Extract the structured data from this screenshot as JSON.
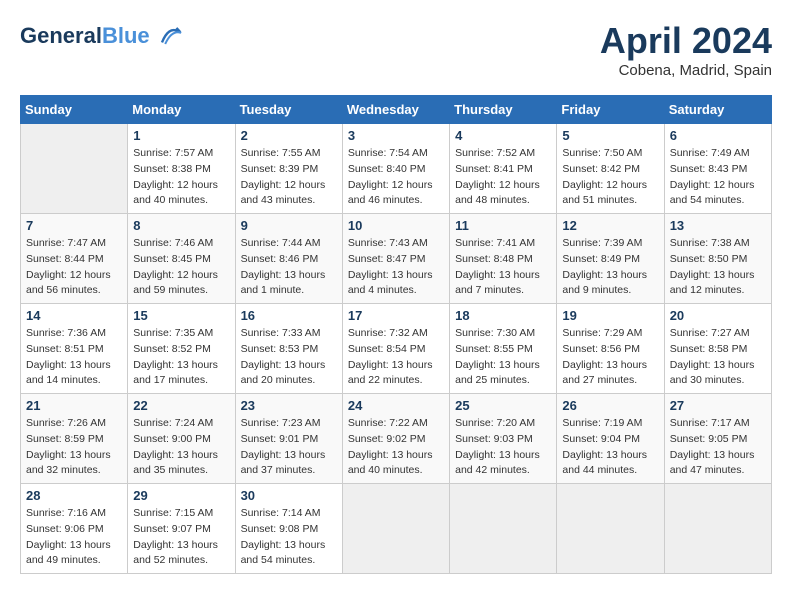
{
  "header": {
    "logo_line1": "General",
    "logo_line2": "Blue",
    "month": "April 2024",
    "location": "Cobena, Madrid, Spain"
  },
  "weekdays": [
    "Sunday",
    "Monday",
    "Tuesday",
    "Wednesday",
    "Thursday",
    "Friday",
    "Saturday"
  ],
  "weeks": [
    [
      {
        "day": null
      },
      {
        "day": "1",
        "sunrise": "7:57 AM",
        "sunset": "8:38 PM",
        "daylight": "12 hours and 40 minutes."
      },
      {
        "day": "2",
        "sunrise": "7:55 AM",
        "sunset": "8:39 PM",
        "daylight": "12 hours and 43 minutes."
      },
      {
        "day": "3",
        "sunrise": "7:54 AM",
        "sunset": "8:40 PM",
        "daylight": "12 hours and 46 minutes."
      },
      {
        "day": "4",
        "sunrise": "7:52 AM",
        "sunset": "8:41 PM",
        "daylight": "12 hours and 48 minutes."
      },
      {
        "day": "5",
        "sunrise": "7:50 AM",
        "sunset": "8:42 PM",
        "daylight": "12 hours and 51 minutes."
      },
      {
        "day": "6",
        "sunrise": "7:49 AM",
        "sunset": "8:43 PM",
        "daylight": "12 hours and 54 minutes."
      }
    ],
    [
      {
        "day": "7",
        "sunrise": "7:47 AM",
        "sunset": "8:44 PM",
        "daylight": "12 hours and 56 minutes."
      },
      {
        "day": "8",
        "sunrise": "7:46 AM",
        "sunset": "8:45 PM",
        "daylight": "12 hours and 59 minutes."
      },
      {
        "day": "9",
        "sunrise": "7:44 AM",
        "sunset": "8:46 PM",
        "daylight": "13 hours and 1 minute."
      },
      {
        "day": "10",
        "sunrise": "7:43 AM",
        "sunset": "8:47 PM",
        "daylight": "13 hours and 4 minutes."
      },
      {
        "day": "11",
        "sunrise": "7:41 AM",
        "sunset": "8:48 PM",
        "daylight": "13 hours and 7 minutes."
      },
      {
        "day": "12",
        "sunrise": "7:39 AM",
        "sunset": "8:49 PM",
        "daylight": "13 hours and 9 minutes."
      },
      {
        "day": "13",
        "sunrise": "7:38 AM",
        "sunset": "8:50 PM",
        "daylight": "13 hours and 12 minutes."
      }
    ],
    [
      {
        "day": "14",
        "sunrise": "7:36 AM",
        "sunset": "8:51 PM",
        "daylight": "13 hours and 14 minutes."
      },
      {
        "day": "15",
        "sunrise": "7:35 AM",
        "sunset": "8:52 PM",
        "daylight": "13 hours and 17 minutes."
      },
      {
        "day": "16",
        "sunrise": "7:33 AM",
        "sunset": "8:53 PM",
        "daylight": "13 hours and 20 minutes."
      },
      {
        "day": "17",
        "sunrise": "7:32 AM",
        "sunset": "8:54 PM",
        "daylight": "13 hours and 22 minutes."
      },
      {
        "day": "18",
        "sunrise": "7:30 AM",
        "sunset": "8:55 PM",
        "daylight": "13 hours and 25 minutes."
      },
      {
        "day": "19",
        "sunrise": "7:29 AM",
        "sunset": "8:56 PM",
        "daylight": "13 hours and 27 minutes."
      },
      {
        "day": "20",
        "sunrise": "7:27 AM",
        "sunset": "8:58 PM",
        "daylight": "13 hours and 30 minutes."
      }
    ],
    [
      {
        "day": "21",
        "sunrise": "7:26 AM",
        "sunset": "8:59 PM",
        "daylight": "13 hours and 32 minutes."
      },
      {
        "day": "22",
        "sunrise": "7:24 AM",
        "sunset": "9:00 PM",
        "daylight": "13 hours and 35 minutes."
      },
      {
        "day": "23",
        "sunrise": "7:23 AM",
        "sunset": "9:01 PM",
        "daylight": "13 hours and 37 minutes."
      },
      {
        "day": "24",
        "sunrise": "7:22 AM",
        "sunset": "9:02 PM",
        "daylight": "13 hours and 40 minutes."
      },
      {
        "day": "25",
        "sunrise": "7:20 AM",
        "sunset": "9:03 PM",
        "daylight": "13 hours and 42 minutes."
      },
      {
        "day": "26",
        "sunrise": "7:19 AM",
        "sunset": "9:04 PM",
        "daylight": "13 hours and 44 minutes."
      },
      {
        "day": "27",
        "sunrise": "7:17 AM",
        "sunset": "9:05 PM",
        "daylight": "13 hours and 47 minutes."
      }
    ],
    [
      {
        "day": "28",
        "sunrise": "7:16 AM",
        "sunset": "9:06 PM",
        "daylight": "13 hours and 49 minutes."
      },
      {
        "day": "29",
        "sunrise": "7:15 AM",
        "sunset": "9:07 PM",
        "daylight": "13 hours and 52 minutes."
      },
      {
        "day": "30",
        "sunrise": "7:14 AM",
        "sunset": "9:08 PM",
        "daylight": "13 hours and 54 minutes."
      },
      {
        "day": null
      },
      {
        "day": null
      },
      {
        "day": null
      },
      {
        "day": null
      }
    ]
  ],
  "labels": {
    "sunrise": "Sunrise:",
    "sunset": "Sunset:",
    "daylight": "Daylight:"
  }
}
